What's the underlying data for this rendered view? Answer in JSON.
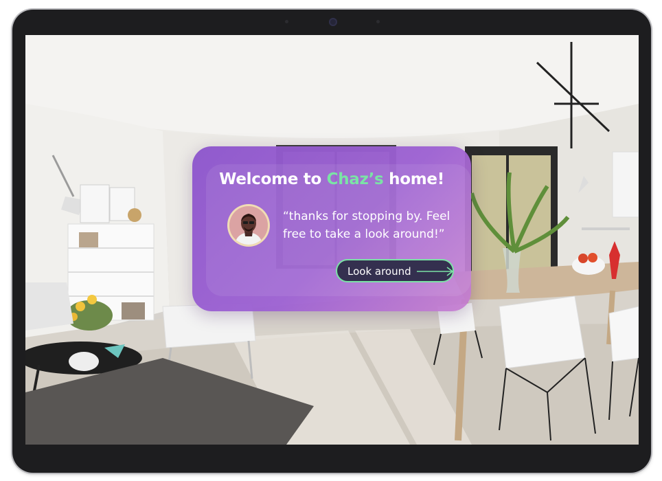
{
  "welcome_panel": {
    "title_prefix": "Welcome to ",
    "title_name": "Chaz’s",
    "title_suffix": " home!",
    "quote": "“thanks for stopping by. Feel free to take a look around!”",
    "cta_label": "Look around",
    "cta_icon": "arrow-right-icon",
    "avatar_icon": "user-avatar"
  },
  "colors": {
    "panel_gradient_start": "#8d56cc",
    "panel_gradient_end": "#c67ed0",
    "highlight_green": "#7be3a6",
    "cta_background": "#34304f",
    "device_bezel": "#1d1d1f"
  }
}
